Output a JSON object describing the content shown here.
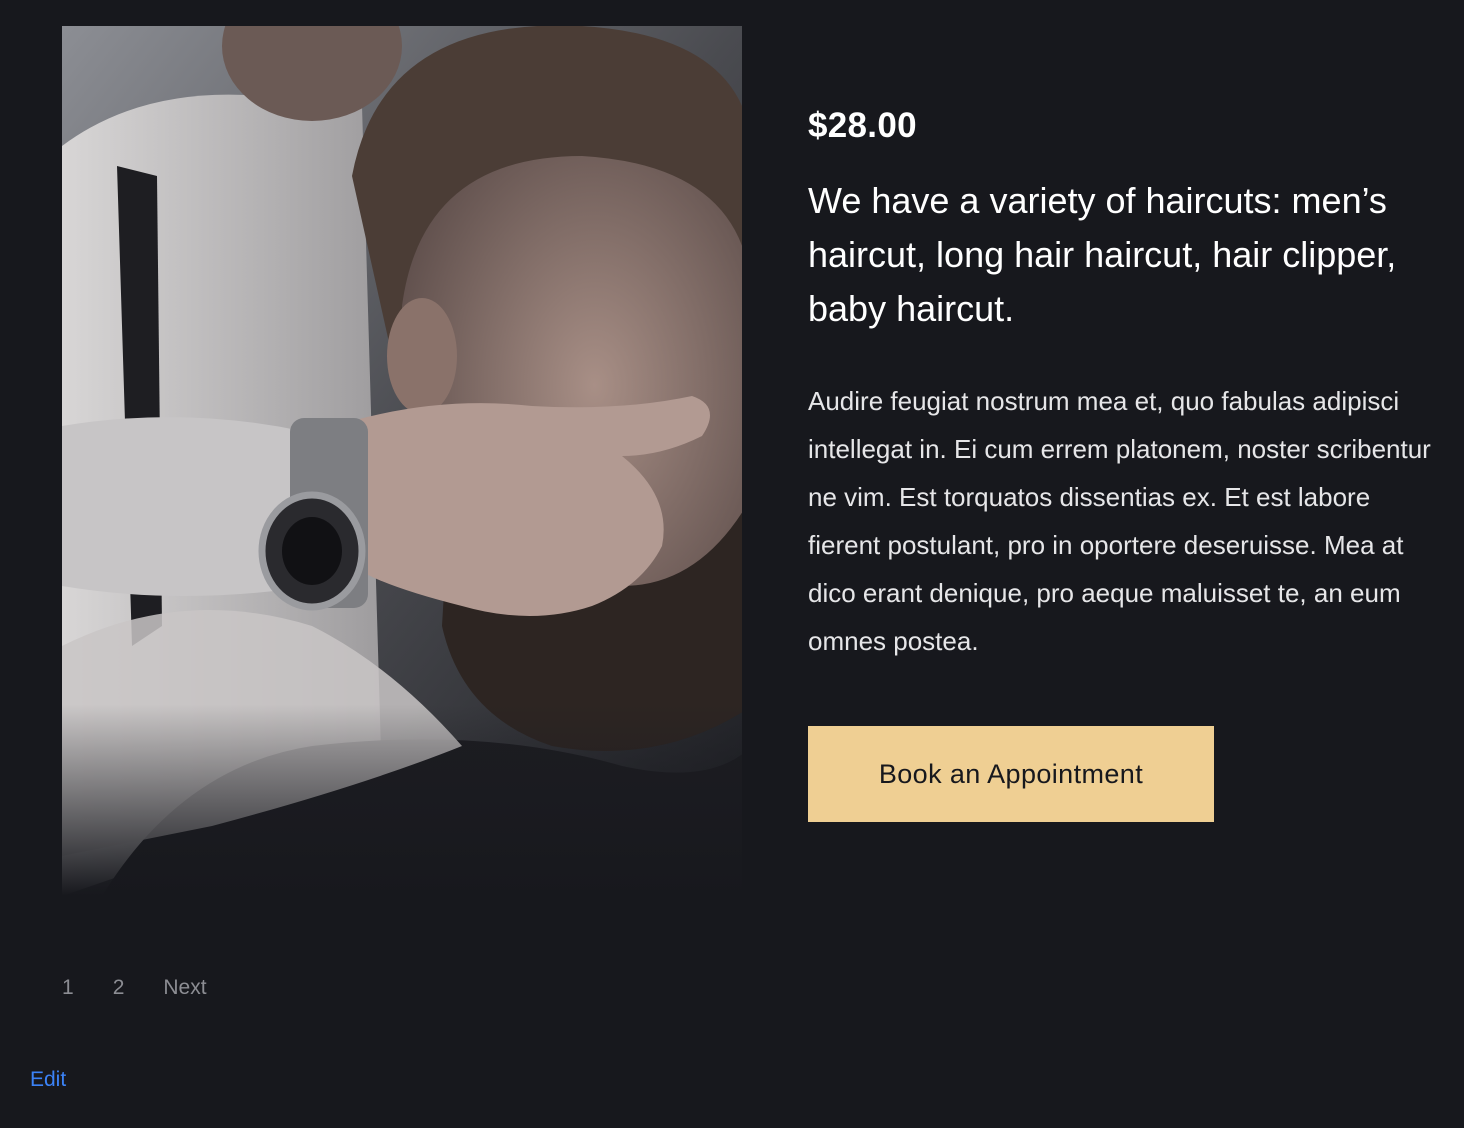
{
  "service": {
    "price": "$28.00",
    "headline": "We have a variety of haircuts: men’s haircut, long hair haircut, hair clipper, baby haircut.",
    "description": "Audire feugiat nostrum mea et, quo fabulas adipisci intellegat in. Ei cum errem platonem, noster scribentur ne vim. Est torquatos dissentias ex. Et est labore fierent postulant, pro in oportere deseruisse. Mea at dico erant denique, pro aeque maluisset te, an eum omnes postea.",
    "book_button_label": "Book an Appointment",
    "image_icon": "barber-photo"
  },
  "pagination": {
    "pages": [
      "1",
      "2"
    ],
    "next_label": "Next",
    "current_page": "1"
  },
  "admin": {
    "edit_label": "Edit"
  },
  "colors": {
    "background": "#17181d",
    "accent_button": "#efcf93",
    "edit_link": "#3b82f6",
    "pagination_text": "#8c8d93"
  }
}
